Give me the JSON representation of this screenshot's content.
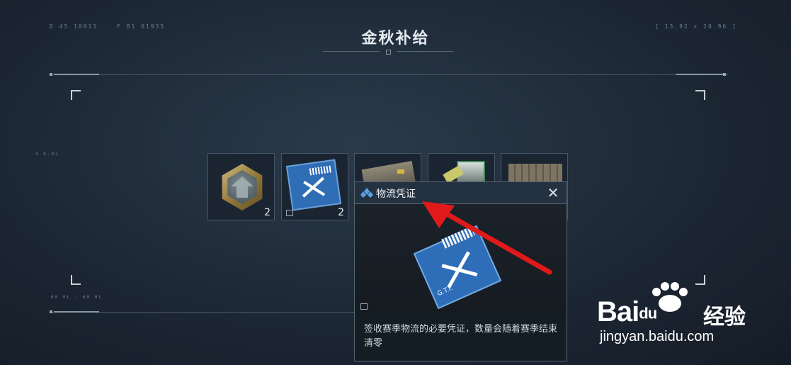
{
  "hud": {
    "top_left_a": "D 45  10011",
    "top_left_b": "F 81  61935",
    "top_right": "[ 13.92 × 20.96 ]",
    "side_left": "4 0.02",
    "bottom_left": "00 0L  ·  00 0L"
  },
  "page": {
    "title": "金秋补给"
  },
  "items": [
    {
      "icon": "medal-icon",
      "qty": "2"
    },
    {
      "icon": "logistics-card-icon",
      "qty": "2"
    },
    {
      "icon": "supply-crate-icon",
      "qty": ""
    },
    {
      "icon": "weapon-parts-icon",
      "qty": ""
    },
    {
      "icon": "ammo-crate-icon",
      "qty": ""
    }
  ],
  "popup": {
    "title": "物流凭证",
    "close_icon": "close-icon",
    "description": "签收赛季物流的必要凭证，数量会随着赛季结束清零",
    "card_label": "G.T.I."
  },
  "watermark": {
    "brand": "Bai",
    "brand_du": "du",
    "product": "经验",
    "url": "jingyan.baidu.com"
  },
  "colors": {
    "background": "#1d2835",
    "popup_header": "#243140",
    "card_blue": "#2e6db8",
    "arrow": "#e01a1a"
  }
}
